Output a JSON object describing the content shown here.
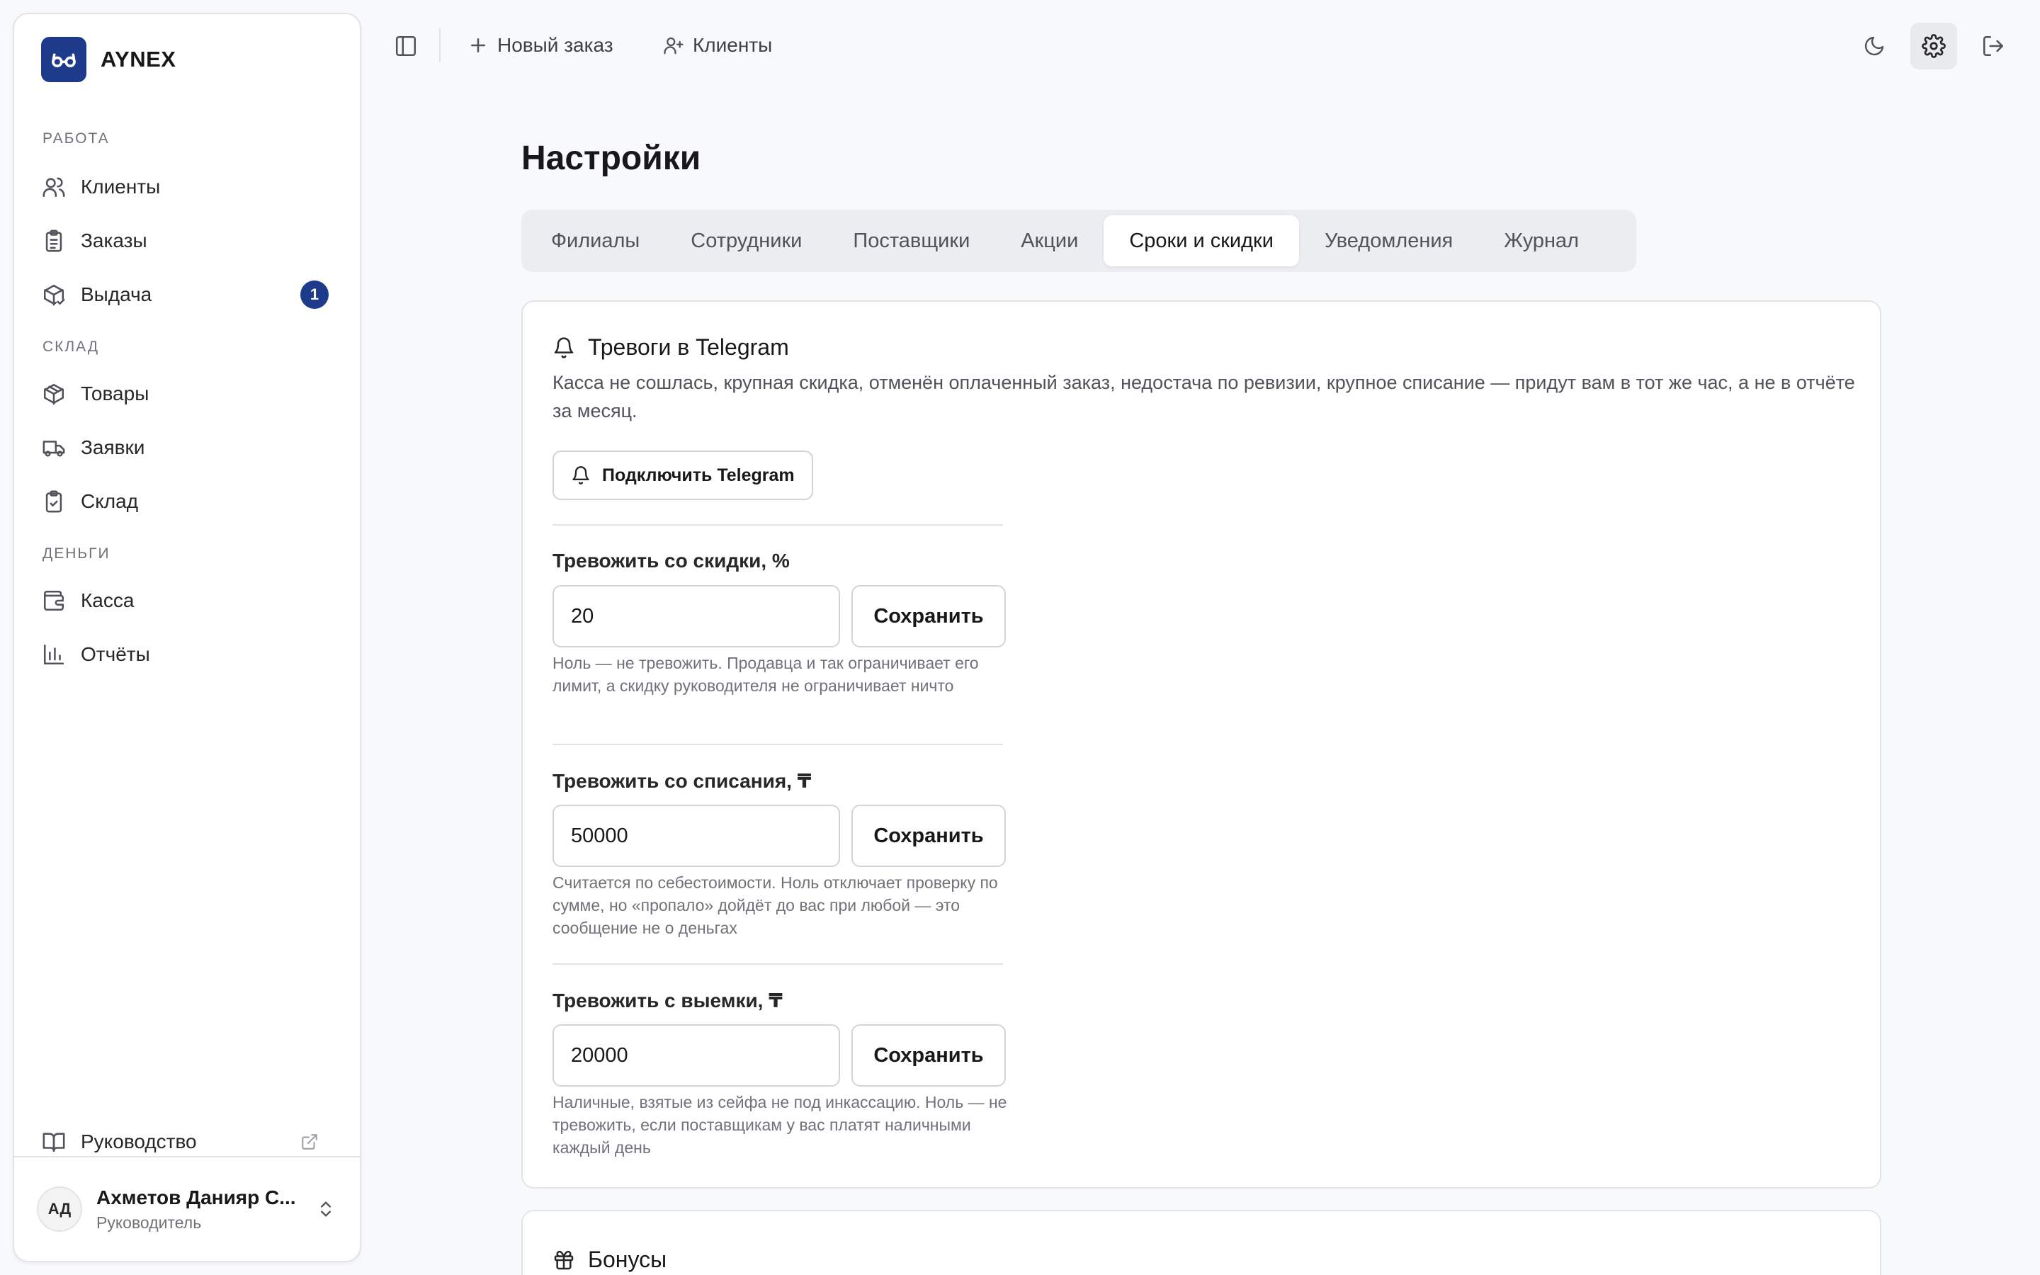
{
  "brand": {
    "name": "AYNEX",
    "accent": "#1e3a8a"
  },
  "sidebar": {
    "sections": [
      {
        "label": "Работа"
      },
      {
        "label": "Склад"
      },
      {
        "label": "Деньги"
      }
    ],
    "items": [
      {
        "label": "Клиенты",
        "icon": "users-icon"
      },
      {
        "label": "Заказы",
        "icon": "clipboard-list-icon"
      },
      {
        "label": "Выдача",
        "icon": "package-check-icon",
        "badge": "1"
      },
      {
        "label": "Товары",
        "icon": "package-icon"
      },
      {
        "label": "Заявки",
        "icon": "truck-icon"
      },
      {
        "label": "Склад",
        "icon": "clipboard-check-icon"
      },
      {
        "label": "Касса",
        "icon": "wallet-icon"
      },
      {
        "label": "Отчёты",
        "icon": "bar-chart-icon"
      }
    ],
    "guide": {
      "label": "Руководство",
      "icon": "book-open-icon"
    },
    "user": {
      "initials": "АД",
      "name": "Ахметов Данияр С...",
      "role": "Руководитель"
    }
  },
  "topbar": {
    "new_order": "Новый заказ",
    "clients": "Клиенты"
  },
  "page": {
    "title": "Настройки",
    "tabs": [
      {
        "label": "Филиалы"
      },
      {
        "label": "Сотрудники"
      },
      {
        "label": "Поставщики"
      },
      {
        "label": "Акции"
      },
      {
        "label": "Сроки и скидки",
        "active": true
      },
      {
        "label": "Уведомления"
      },
      {
        "label": "Журнал"
      }
    ]
  },
  "telegram_card": {
    "title": "Тревоги в Telegram",
    "description": "Касса не сошлась, крупная скидка, отменён оплаченный заказ, недостача по ревизии, крупное списание — придут вам в тот же час, а не в отчёте за месяц.",
    "connect_label": "Подключить Telegram",
    "fields": [
      {
        "label": "Тревожить со скидки, %",
        "value": "20",
        "save": "Сохранить",
        "help": "Ноль — не тревожить. Продавца и так ограничивает его лимит, а скидку руководителя не ограничивает ничто"
      },
      {
        "label": "Тревожить со списания, ₸",
        "value": "50000",
        "save": "Сохранить",
        "help": "Считается по себестоимости. Ноль отключает проверку по сумме, но «пропало» дойдёт до вас при любой — это сообщение не о деньгах"
      },
      {
        "label": "Тревожить с выемки, ₸",
        "value": "20000",
        "save": "Сохранить",
        "help": "Наличные, взятые из сейфа не под инкассацию. Ноль — не тревожить, если поставщикам у вас платят наличными каждый день"
      }
    ]
  },
  "bonus_card": {
    "title": "Бонусы"
  }
}
